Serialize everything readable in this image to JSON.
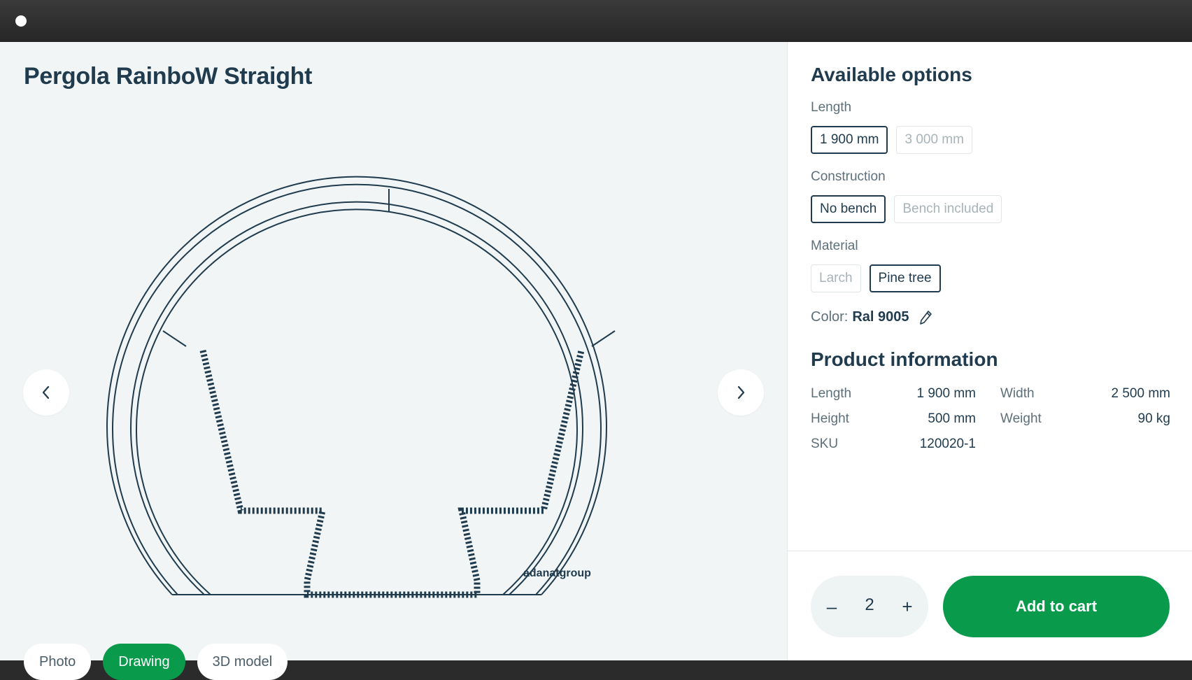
{
  "product": {
    "title": "Pergola RainboW Straight",
    "brand_watermark": "adanatgroup"
  },
  "viewer": {
    "prev_icon": "chevron-left-icon",
    "next_icon": "chevron-right-icon",
    "tabs": [
      {
        "label": "Photo",
        "active": false
      },
      {
        "label": "Drawing",
        "active": true
      },
      {
        "label": "3D model",
        "active": false
      }
    ]
  },
  "options": {
    "heading": "Available options",
    "length": {
      "label": "Length",
      "choices": [
        "1 900 mm",
        "3 000 mm"
      ],
      "selected": "1 900 mm"
    },
    "construction": {
      "label": "Construction",
      "choices": [
        "No bench",
        "Bench included"
      ],
      "selected": "No bench"
    },
    "material": {
      "label": "Material",
      "choices": [
        "Larch",
        "Pine tree"
      ],
      "selected": "Pine tree"
    },
    "color": {
      "label": "Color:",
      "value": "Ral 9005",
      "edit_icon": "pencil-icon"
    }
  },
  "info": {
    "heading": "Product information",
    "rows": [
      {
        "k1": "Length",
        "v1": "1 900 mm",
        "k2": "Width",
        "v2": "2 500 mm"
      },
      {
        "k1": "Height",
        "v1": "500 mm",
        "k2": "Weight",
        "v2": "90 kg"
      },
      {
        "k1": "SKU",
        "v1": "120020-1",
        "k2": "",
        "v2": ""
      }
    ]
  },
  "cart": {
    "minus": "–",
    "quantity": "2",
    "plus": "+",
    "add_label": "Add to cart"
  },
  "colors": {
    "accent": "#0a9a4c",
    "ink": "#1f3b4d",
    "muted": "#5d6f79",
    "viewer_bg": "#f1f5f5"
  }
}
